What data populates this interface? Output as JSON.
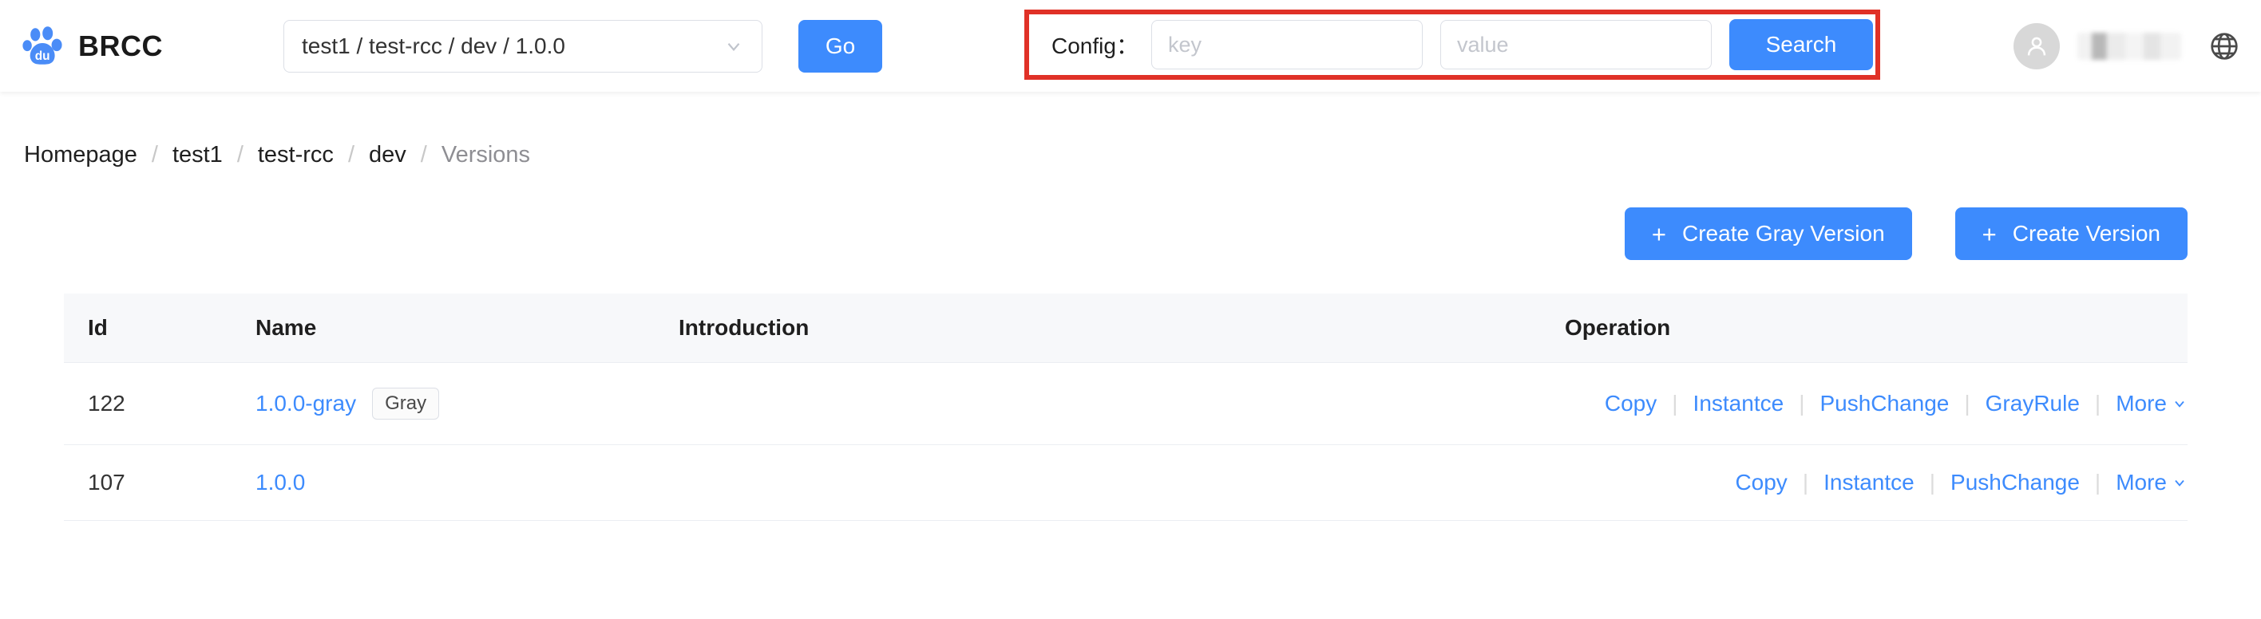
{
  "header": {
    "brand_name": "BRCC",
    "logo_icon": "baidu-paw-logo",
    "env_selector": {
      "value": "test1 / test-rcc / dev / 1.0.0",
      "chevron_icon": "chevron-down-icon"
    },
    "go_label": "Go",
    "config": {
      "label": "Config：",
      "key_placeholder": "key",
      "key_value": "",
      "value_placeholder": "value",
      "value_value": "",
      "search_label": "Search",
      "highlight_color": "#e03127"
    },
    "user": {
      "avatar_icon": "user-avatar-icon",
      "username": "",
      "language_icon": "globe-icon"
    }
  },
  "breadcrumb": {
    "items": [
      {
        "label": "Homepage",
        "current": false
      },
      {
        "label": "test1",
        "current": false
      },
      {
        "label": "test-rcc",
        "current": false
      },
      {
        "label": "dev",
        "current": false
      },
      {
        "label": "Versions",
        "current": true
      }
    ],
    "separator": "/"
  },
  "actions": {
    "plus_icon": "plus-icon",
    "create_gray_version": "Create Gray Version",
    "create_version": "Create Version"
  },
  "table": {
    "columns": [
      "Id",
      "Name",
      "Introduction",
      "Operation"
    ],
    "rows": [
      {
        "id": "122",
        "name": "1.0.0-gray",
        "tag": "Gray",
        "introduction": "",
        "operations": [
          "Copy",
          "Instantce",
          "PushChange",
          "GrayRule",
          "More"
        ],
        "more_label": "More",
        "more_icon": "chevron-down-icon"
      },
      {
        "id": "107",
        "name": "1.0.0",
        "tag": "",
        "introduction": "",
        "operations": [
          "Copy",
          "Instantce",
          "PushChange",
          "More"
        ],
        "more_label": "More",
        "more_icon": "chevron-down-icon"
      }
    ]
  },
  "colors": {
    "accent": "#3d8bfd",
    "highlight": "#e03127",
    "table_header_bg": "#f7f8fa",
    "border": "#ebeef2"
  }
}
